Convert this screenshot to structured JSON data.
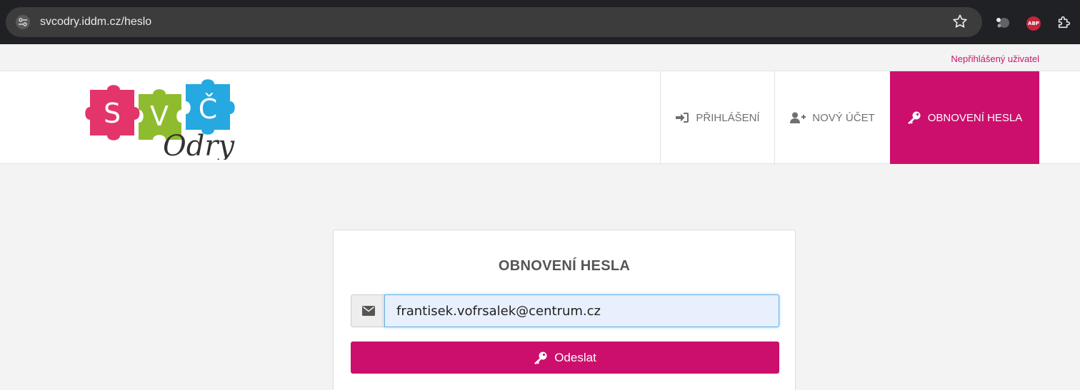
{
  "browser": {
    "url": "svcodry.iddm.cz/heslo",
    "icons": [
      "site-info-icon",
      "bookmark-star-icon",
      "extension-icon",
      "adblock-plus-icon",
      "extensions-puzzle-icon"
    ],
    "abp_label": "ABP"
  },
  "user_status": "Nepřihlášený uživatel",
  "logo": {
    "letters": [
      "S",
      "V",
      "Č"
    ],
    "script": "Odry"
  },
  "nav": [
    {
      "label": "PŘIHLÁŠENÍ",
      "icon": "sign-in-icon"
    },
    {
      "label": "NOVÝ ÚČET",
      "icon": "user-plus-icon"
    },
    {
      "label": "OBNOVENÍ HESLA",
      "icon": "key-icon",
      "active": true
    }
  ],
  "form": {
    "title": "OBNOVENÍ HESLA",
    "email_value": "frantisek.vofrsalek@centrum.cz",
    "email_icon": "envelope-icon",
    "submit_label": "Odeslat",
    "submit_icon": "key-icon"
  },
  "colors": {
    "accent": "#cc0f6c",
    "browser_bg": "#202124",
    "omnibox": "#3c3c3c"
  }
}
